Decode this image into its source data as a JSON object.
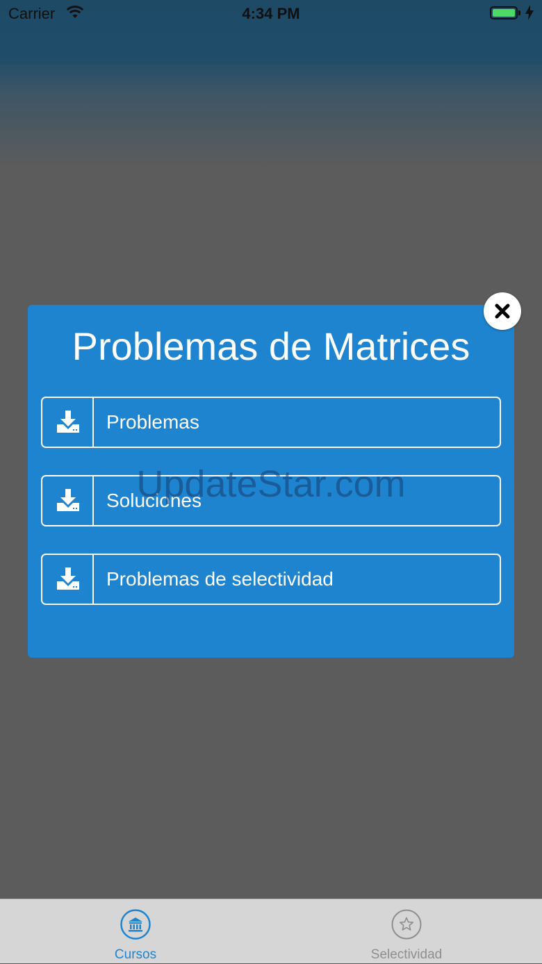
{
  "status_bar": {
    "carrier": "Carrier",
    "time": "4:34 PM",
    "battery_level": 1.0
  },
  "modal": {
    "title": "Problemas de Matrices",
    "close_icon": "close-icon",
    "buttons": [
      {
        "label": "Problemas",
        "icon": "download-icon"
      },
      {
        "label": "Soluciones",
        "icon": "download-icon"
      },
      {
        "label": "Problemas de selectividad",
        "icon": "download-icon"
      }
    ],
    "color": "#1e84cf"
  },
  "watermark": "UpdateStar.com",
  "tab_bar": {
    "tabs": [
      {
        "label": "Cursos",
        "icon": "institution-icon",
        "selected": true,
        "color": "#1e84cf"
      },
      {
        "label": "Selectividad",
        "icon": "star-icon",
        "selected": false,
        "color": "#8e8e8e"
      }
    ]
  }
}
